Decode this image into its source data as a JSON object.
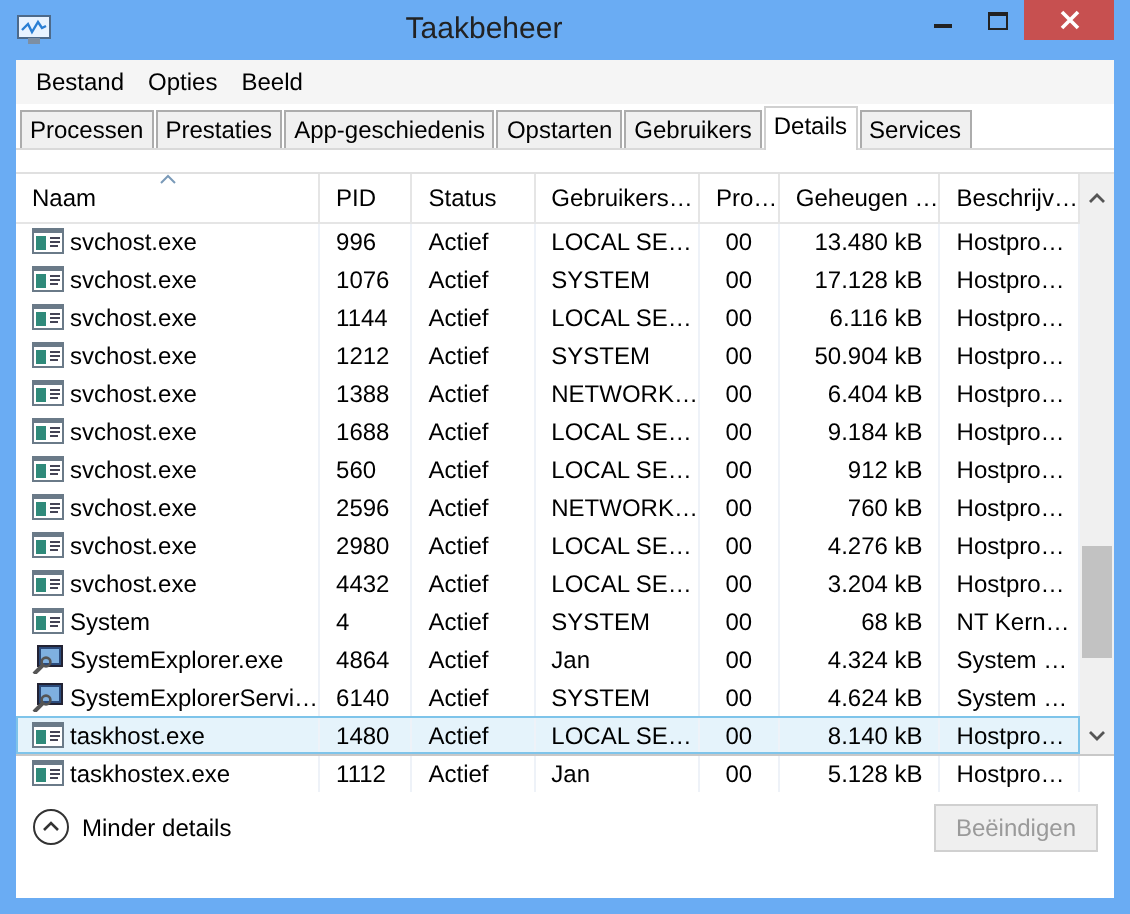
{
  "window": {
    "title": "Taakbeheer"
  },
  "menu": [
    "Bestand",
    "Opties",
    "Beeld"
  ],
  "tabs": [
    {
      "label": "Processen",
      "selected": false
    },
    {
      "label": "Prestaties",
      "selected": false
    },
    {
      "label": "App-geschiedenis",
      "selected": false
    },
    {
      "label": "Opstarten",
      "selected": false
    },
    {
      "label": "Gebruikers",
      "selected": false
    },
    {
      "label": "Details",
      "selected": true
    },
    {
      "label": "Services",
      "selected": false
    }
  ],
  "table": {
    "columns": [
      {
        "label": "Naam",
        "sorted": true
      },
      {
        "label": "PID",
        "sorted": false
      },
      {
        "label": "Status",
        "sorted": false
      },
      {
        "label": "Gebruikers…",
        "sorted": false
      },
      {
        "label": "Pro…",
        "sorted": false
      },
      {
        "label": "Geheugen …",
        "sorted": false
      },
      {
        "label": "Beschrijv…",
        "sorted": false
      }
    ],
    "rows": [
      {
        "kind": "service",
        "selected": false,
        "cells": [
          "svchost.exe",
          "996",
          "Actief",
          "LOCAL SE…",
          "00",
          "13.480 kB",
          "Hostpro…"
        ]
      },
      {
        "kind": "service",
        "selected": false,
        "cells": [
          "svchost.exe",
          "1076",
          "Actief",
          "SYSTEM",
          "00",
          "17.128 kB",
          "Hostpro…"
        ]
      },
      {
        "kind": "service",
        "selected": false,
        "cells": [
          "svchost.exe",
          "1144",
          "Actief",
          "LOCAL SE…",
          "00",
          "6.116 kB",
          "Hostpro…"
        ]
      },
      {
        "kind": "service",
        "selected": false,
        "cells": [
          "svchost.exe",
          "1212",
          "Actief",
          "SYSTEM",
          "00",
          "50.904 kB",
          "Hostpro…"
        ]
      },
      {
        "kind": "service",
        "selected": false,
        "cells": [
          "svchost.exe",
          "1388",
          "Actief",
          "NETWORK…",
          "00",
          "6.404 kB",
          "Hostpro…"
        ]
      },
      {
        "kind": "service",
        "selected": false,
        "cells": [
          "svchost.exe",
          "1688",
          "Actief",
          "LOCAL SE…",
          "00",
          "9.184 kB",
          "Hostpro…"
        ]
      },
      {
        "kind": "service",
        "selected": false,
        "cells": [
          "svchost.exe",
          "560",
          "Actief",
          "LOCAL SE…",
          "00",
          "912 kB",
          "Hostpro…"
        ]
      },
      {
        "kind": "service",
        "selected": false,
        "cells": [
          "svchost.exe",
          "2596",
          "Actief",
          "NETWORK…",
          "00",
          "760 kB",
          "Hostpro…"
        ]
      },
      {
        "kind": "service",
        "selected": false,
        "cells": [
          "svchost.exe",
          "2980",
          "Actief",
          "LOCAL SE…",
          "00",
          "4.276 kB",
          "Hostpro…"
        ]
      },
      {
        "kind": "service",
        "selected": false,
        "cells": [
          "svchost.exe",
          "4432",
          "Actief",
          "LOCAL SE…",
          "00",
          "3.204 kB",
          "Hostpro…"
        ]
      },
      {
        "kind": "service",
        "selected": false,
        "cells": [
          "System",
          "4",
          "Actief",
          "SYSTEM",
          "00",
          "68 kB",
          "NT Kern…"
        ]
      },
      {
        "kind": "app",
        "selected": false,
        "cells": [
          "SystemExplorer.exe",
          "4864",
          "Actief",
          "Jan",
          "00",
          "4.324 kB",
          "System …"
        ]
      },
      {
        "kind": "app",
        "selected": false,
        "cells": [
          "SystemExplorerServi…",
          "6140",
          "Actief",
          "SYSTEM",
          "00",
          "4.624 kB",
          "System …"
        ]
      },
      {
        "kind": "service",
        "selected": true,
        "cells": [
          "taskhost.exe",
          "1480",
          "Actief",
          "LOCAL SE…",
          "00",
          "8.140 kB",
          "Hostpro…"
        ]
      },
      {
        "kind": "service",
        "selected": false,
        "cells": [
          "taskhostex.exe",
          "1112",
          "Actief",
          "Jan",
          "00",
          "5.128 kB",
          "Hostpro…"
        ]
      }
    ]
  },
  "footer": {
    "toggle": "Minder details",
    "end_button": {
      "label": "Beëindigen",
      "disabled": true
    }
  }
}
